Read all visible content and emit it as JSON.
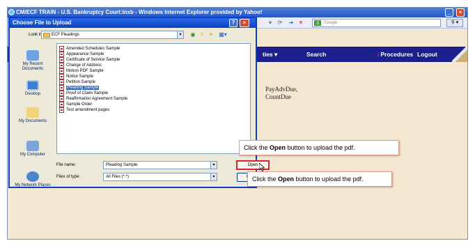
{
  "browser": {
    "title": "CM/ECF TRAIN - U.S. Bankruptcy Court:inxb - Windows Internet Explorer provided by Yahoo!",
    "search_placeholder": "Google"
  },
  "nav": {
    "utilities": "ties ▾",
    "search": "Search",
    "procedures": "Procedures",
    "procedures_badge": "i",
    "logout": "Logout"
  },
  "background_text": {
    "line1": "PayAdvDue,",
    "line2": "CountDue"
  },
  "dialog": {
    "title": "Choose File to Upload",
    "look_in_label": "Look in:",
    "look_in_value": "ECF Pleadings",
    "places": {
      "recent": "My Recent Documents",
      "desktop": "Desktop",
      "documents": "My Documents",
      "computer": "My Computer",
      "network": "My Network Places"
    },
    "files": [
      {
        "name": "Amended Schedules Sample"
      },
      {
        "name": "Appearance Sample"
      },
      {
        "name": "Certificate of Service Sample"
      },
      {
        "name": "Change of Address"
      },
      {
        "name": "Motion PDF Sample"
      },
      {
        "name": "Notice Sample"
      },
      {
        "name": "Petition Sample"
      },
      {
        "name": "Pleading Sample"
      },
      {
        "name": "Proof of Claim Sample"
      },
      {
        "name": "Reaffirmation Agreement Sample"
      },
      {
        "name": "Sample Order"
      },
      {
        "name": "Test amendment pages"
      }
    ],
    "selected_file": "Pleading Sample",
    "file_name_label": "File name:",
    "file_name_value": "Pleading Sample",
    "file_type_label": "Files of type:",
    "file_type_value": "All Files (*.*)",
    "open_button": "Open",
    "cancel_button": "Cancel"
  },
  "callouts": {
    "prefix": "Click the ",
    "bold": "Open",
    "suffix": " button to upload the pdf."
  }
}
